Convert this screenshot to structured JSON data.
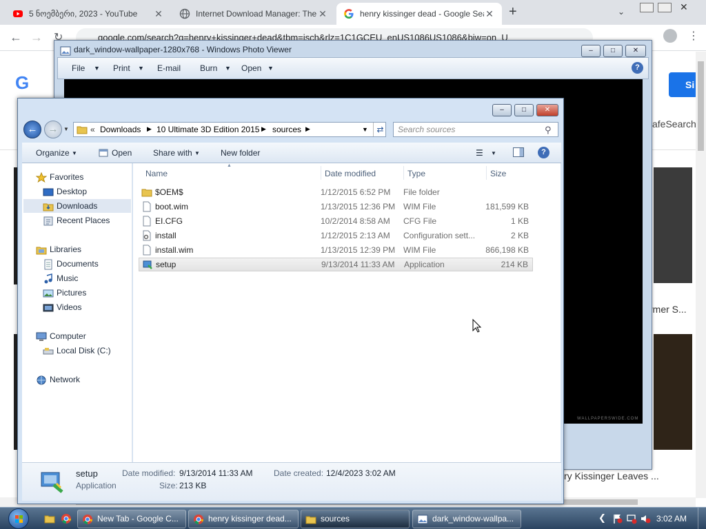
{
  "chrome": {
    "tabs": [
      {
        "label": "5 ნოემბერი, 2023 - YouTube",
        "icon": "youtube-icon"
      },
      {
        "label": "Internet Download Manager: The",
        "icon": "globe-icon"
      },
      {
        "label": "henry kissinger dead - Google Sea",
        "icon": "google-icon"
      }
    ],
    "new_tab": "+",
    "tab_close": "✕",
    "url": "google.com/search?q=henry+kissinger+dead&tbm=isch&rlz=1C1GCEU_enUS1086US1086&biw=on_U",
    "page_fragments": {
      "sign_in": "Si",
      "safesearch": "afeSearch",
      "caption_1": "rmer S...",
      "caption_2": "ry Kissinger Leaves ..."
    }
  },
  "photo_viewer": {
    "title": "dark_window-wallpaper-1280x768 - Windows Photo Viewer",
    "menu": [
      "File",
      "Print",
      "E-mail",
      "Burn",
      "Open"
    ],
    "watermark": "WALLPAPERSWIDE.COM"
  },
  "explorer": {
    "breadcrumb": [
      "Downloads",
      "10 Ultimate 3D Edition 2015",
      "sources"
    ],
    "breadcrumb_prefix": "«",
    "search_placeholder": "Search sources",
    "commands": {
      "organize": "Organize",
      "open": "Open",
      "share_with": "Share with",
      "new_folder": "New folder"
    },
    "nav": {
      "favorites": "Favorites",
      "desktop": "Desktop",
      "downloads": "Downloads",
      "recent_places": "Recent Places",
      "libraries": "Libraries",
      "documents": "Documents",
      "music": "Music",
      "pictures": "Pictures",
      "videos": "Videos",
      "computer": "Computer",
      "local_disk": "Local Disk (C:)",
      "network": "Network"
    },
    "columns": {
      "name": "Name",
      "date": "Date modified",
      "type": "Type",
      "size": "Size"
    },
    "files": [
      {
        "name": "$OEM$",
        "date": "1/12/2015 6:52 PM",
        "type": "File folder",
        "size": "",
        "icon": "folder-icon"
      },
      {
        "name": "boot.wim",
        "date": "1/13/2015 12:36 PM",
        "type": "WIM File",
        "size": "181,599 KB",
        "icon": "file-icon"
      },
      {
        "name": "EI.CFG",
        "date": "10/2/2014 8:58 AM",
        "type": "CFG File",
        "size": "1 KB",
        "icon": "file-icon"
      },
      {
        "name": "install",
        "date": "1/12/2015 2:13 AM",
        "type": "Configuration sett...",
        "size": "2 KB",
        "icon": "config-file-icon"
      },
      {
        "name": "install.wim",
        "date": "1/13/2015 12:39 PM",
        "type": "WIM File",
        "size": "866,198 KB",
        "icon": "file-icon"
      },
      {
        "name": "setup",
        "date": "9/13/2014 11:33 AM",
        "type": "Application",
        "size": "214 KB",
        "icon": "setup-app-icon"
      }
    ],
    "selected_index": 5,
    "details": {
      "name": "setup",
      "kind": "Application",
      "date_modified_label": "Date modified:",
      "date_modified": "9/13/2014 11:33 AM",
      "date_created_label": "Date created:",
      "date_created": "12/4/2023 3:02 AM",
      "size_label": "Size:",
      "size": "213 KB"
    }
  },
  "taskbar": {
    "buttons": [
      {
        "label": "New Tab - Google C...",
        "icon": "chrome-icon"
      },
      {
        "label": "henry kissinger dead...",
        "icon": "chrome-icon"
      },
      {
        "label": "sources",
        "icon": "folder-icon"
      },
      {
        "label": "dark_window-wallpa...",
        "icon": "photo-viewer-icon"
      }
    ],
    "clock": "3:02 AM"
  }
}
